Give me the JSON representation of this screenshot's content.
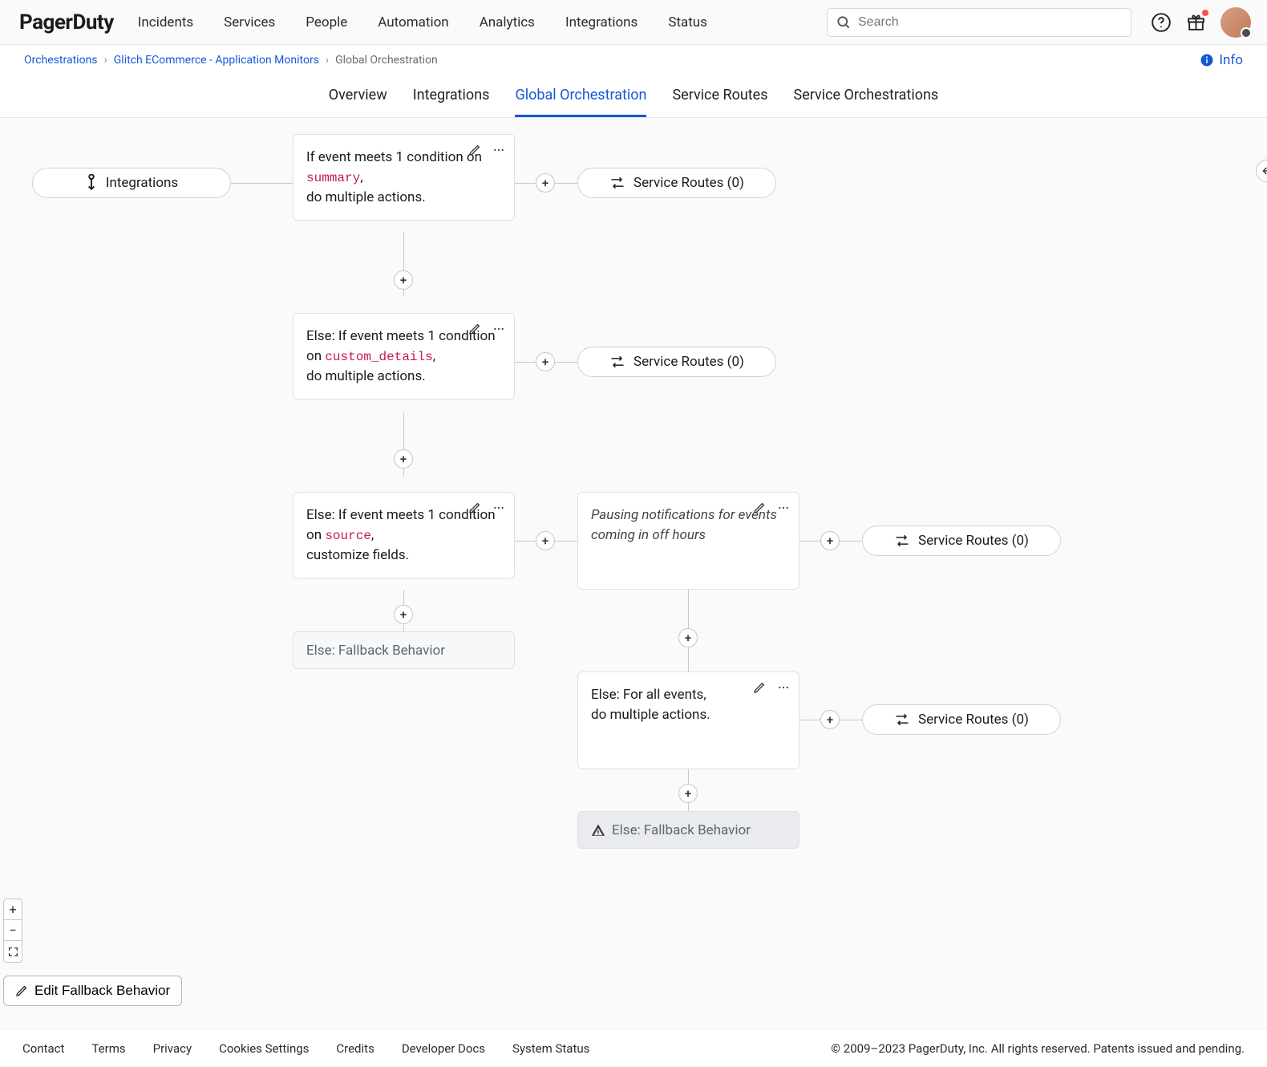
{
  "logo": "PagerDuty",
  "mainnav": [
    "Incidents",
    "Services",
    "People",
    "Automation",
    "Analytics",
    "Integrations",
    "Status"
  ],
  "search_placeholder": "Search",
  "breadcrumb": {
    "items": [
      "Orchestrations",
      "Glitch ECommerce - Application Monitors"
    ],
    "current": "Global Orchestration"
  },
  "info_label": "Info",
  "subnav": [
    "Overview",
    "Integrations",
    "Global Orchestration",
    "Service Routes",
    "Service Orchestrations"
  ],
  "subnav_active_index": 2,
  "labels": {
    "integrations_pill": "Integrations",
    "service_routes_pill": "Service Routes (0)",
    "fallback": "Else: Fallback Behavior",
    "edit_fallback": "Edit Fallback Behavior"
  },
  "rules": {
    "r1_pre": "If event meets 1 condition on ",
    "r1_code": "summary",
    "r1_post": ",\ndo multiple actions.",
    "r2_pre": "Else: If event meets 1 condition on ",
    "r2_code": "custom_details",
    "r2_post": ",\ndo multiple actions.",
    "r3_pre": "Else: If event meets 1 condition on ",
    "r3_code": "source",
    "r3_post": ",\ncustomize fields.",
    "r4_text": "Pausing notifications for events coming in off hours",
    "r5_text": "Else: For all events,\ndo multiple actions."
  },
  "footer": {
    "links": [
      "Contact",
      "Terms",
      "Privacy",
      "Cookies Settings",
      "Credits",
      "Developer Docs",
      "System Status"
    ],
    "copyright": "© 2009–2023 PagerDuty, Inc. All rights reserved. Patents issued and pending."
  }
}
